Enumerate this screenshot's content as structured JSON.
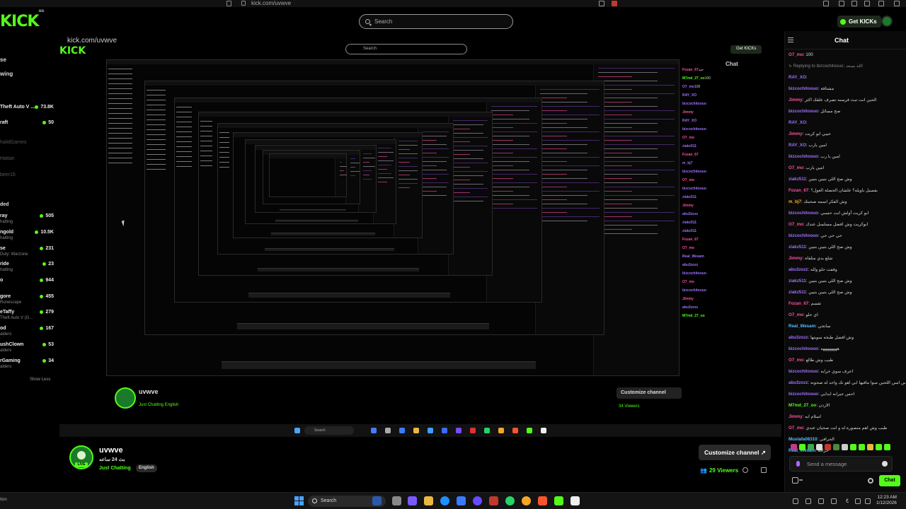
{
  "browser": {
    "url": "kick.com/uvwve"
  },
  "header": {
    "logo": "KICK",
    "logo_sup": "BETA",
    "search_placeholder": "Search",
    "get_kicks": "Get KICKs"
  },
  "sidebar": {
    "nav": [
      "se",
      "wing"
    ],
    "top_items": [
      {
        "name": "Theft Auto V ...",
        "viewers": "73.8K"
      },
      {
        "name": "raft",
        "viewers": "50"
      }
    ],
    "dim_items": [
      "halidGames",
      "Hattan",
      "beer16"
    ],
    "recommended_label": "ded",
    "items": [
      {
        "name": "ray",
        "sub": "hatting",
        "viewers": "505"
      },
      {
        "name": "ngold",
        "sub": "hatting",
        "viewers": "10.5K"
      },
      {
        "name": "se",
        "sub": "Duty: Warzone",
        "viewers": "231"
      },
      {
        "name": "ride",
        "sub": "hatting",
        "viewers": "23"
      },
      {
        "name": "o",
        "sub": "",
        "viewers": "944"
      },
      {
        "name": "gore",
        "sub": "Runescape",
        "viewers": "455"
      },
      {
        "name": "eTaffy",
        "sub": "Theft Auto V (G...",
        "viewers": "279"
      },
      {
        "name": "od",
        "sub": "alders",
        "viewers": "167"
      },
      {
        "name": "ushClown",
        "sub": "alders",
        "viewers": "53"
      },
      {
        "name": "rGaming",
        "sub": "alders",
        "viewers": "34"
      }
    ],
    "show_less": "Show Less"
  },
  "video": {
    "url": "kick.com/uvwve",
    "search": "Search",
    "get_kicks": "Get KICKs",
    "chat_label": "Chat",
    "channel": "uvwve",
    "category": "Just Chatting  English",
    "customize": "Customize channel",
    "viewers": "34 Viewers",
    "task_search": "Search",
    "chat_lines": [
      {
        "u": "Fozan_67",
        "t": "حيه",
        "c": "pk"
      },
      {
        "u": "M7md_27_oo",
        "t": "100",
        "c": "gn"
      },
      {
        "u": "O7_mo",
        "t": "100",
        "c": ""
      },
      {
        "u": "RAY_XO",
        "t": "",
        "c": ""
      },
      {
        "u": "bizcochitoouo",
        "t": "",
        "c": ""
      },
      {
        "u": "Jimmy",
        "t": "",
        "c": "pk"
      },
      {
        "u": "RAY_XO",
        "t": "",
        "c": ""
      },
      {
        "u": "bizcochitoouo",
        "t": "",
        "c": ""
      },
      {
        "u": "O7_mo",
        "t": "",
        "c": "pk"
      },
      {
        "u": "ziakz511",
        "t": "",
        "c": ""
      },
      {
        "u": "Fozan_67",
        "t": "",
        "c": "pk"
      },
      {
        "u": "m_bj7",
        "t": "",
        "c": ""
      },
      {
        "u": "bizcochitoouo",
        "t": "",
        "c": ""
      },
      {
        "u": "O7_mo",
        "t": "",
        "c": "pk"
      },
      {
        "u": "bizcochitoouo",
        "t": "",
        "c": ""
      },
      {
        "u": "ziakz511",
        "t": "",
        "c": ""
      },
      {
        "u": "Jimmy",
        "t": "",
        "c": "pk"
      },
      {
        "u": "abu3zozz",
        "t": "",
        "c": ""
      },
      {
        "u": "ziakz511",
        "t": "",
        "c": ""
      },
      {
        "u": "ziakz511",
        "t": "",
        "c": ""
      },
      {
        "u": "Fozan_67",
        "t": "",
        "c": "pk"
      },
      {
        "u": "O7_mo",
        "t": "",
        "c": "pk"
      },
      {
        "u": "Real_Wesam",
        "t": "",
        "c": ""
      },
      {
        "u": "abu3zozz",
        "t": "",
        "c": ""
      },
      {
        "u": "bizcochitoouo",
        "t": "",
        "c": ""
      },
      {
        "u": "O7_mo",
        "t": "",
        "c": "pk"
      },
      {
        "u": "bizcochitoouo",
        "t": "",
        "c": ""
      },
      {
        "u": "Jimmy",
        "t": "",
        "c": "pk"
      },
      {
        "u": "abu3zozz",
        "t": "",
        "c": ""
      },
      {
        "u": "M7md_27_oo",
        "t": "",
        "c": "gn"
      }
    ]
  },
  "channel": {
    "name": "uvwve",
    "title": "بث 24 ساعه",
    "category": "Just Chatting",
    "tag": "English",
    "live_badge": "LIVE",
    "customize": "Customize channel",
    "viewers": "29 Viewers"
  },
  "chat": {
    "title": "Chat",
    "messages": [
      {
        "user": "O7_mo",
        "text": ": 100",
        "color": "#ff4fa0"
      },
      {
        "user": "",
        "text": "↳ Replying to bizcochitoouo: الله يسعد",
        "color": "#888888",
        "reply": true
      },
      {
        "user": "RAY_XO",
        "text": ": ",
        "color": "#a070ff"
      },
      {
        "user": "bizcochitoouo",
        "text": ": مشتاقة",
        "color": "#a070ff"
      },
      {
        "user": "Jimmy",
        "text": ": الحين انت تبث فرسنه تصرف علقك اكثر",
        "color": "#ff4fa0"
      },
      {
        "user": "bizcochitoouo",
        "text": ": صح مسائل",
        "color": "#a070ff"
      },
      {
        "user": "RAY_XO",
        "text": ": ",
        "color": "#a070ff"
      },
      {
        "user": "Jimmy",
        "text": ": حييي ابو كريت",
        "color": "#ff4fa0"
      },
      {
        "user": "RAY_XO",
        "text": ": امين يارب",
        "color": "#a070ff"
      },
      {
        "user": "bizcochitoouo",
        "text": ": امين يا رب",
        "color": "#a070ff"
      },
      {
        "user": "O7_mo",
        "text": ": امين يارب",
        "color": "#ff4fa0"
      },
      {
        "user": "ziakz511",
        "text": ": وش صح اللي بتبين بتبين",
        "color": "#a070ff"
      },
      {
        "user": "Fozan_67",
        "text": ": بفسيل ياويله؟ علشان الحصلة الغول؟",
        "color": "#ff4fa0"
      },
      {
        "user": "m_bj7",
        "text": ": وش الفكر اسمه صحيتك",
        "color": "#ffb020"
      },
      {
        "user": "bizcochitoouo",
        "text": ": ابو كريت أولش انت حسبي",
        "color": "#a070ff"
      },
      {
        "user": "O7_mo",
        "text": ": ابوكريت وش افضل مسلسل عندك",
        "color": "#ff4fa0"
      },
      {
        "user": "bizcochitoouo",
        "text": ": حي حي حي",
        "color": "#a070ff"
      },
      {
        "user": "ziakz511",
        "text": ": وش صح اللي بتبين بتبين",
        "color": "#a070ff"
      },
      {
        "user": "Jimmy",
        "text": ": شلع بدي متلقاة",
        "color": "#ff4fa0"
      },
      {
        "user": "abu3zozz",
        "text": ": وقفت حلو ولله",
        "color": "#a070ff"
      },
      {
        "user": "ziakz511",
        "text": ": وش صح اللي بتبين بتبين",
        "color": "#a070ff"
      },
      {
        "user": "ziakz511",
        "text": ": وش صح اللي بتبين بتبين",
        "color": "#a070ff"
      },
      {
        "user": "Fozan_67",
        "text": ": تقسم",
        "color": "#ff4fa0"
      },
      {
        "user": "O7_mo",
        "text": ": اي حلو",
        "color": "#ff4fa0"
      },
      {
        "user": "Real_Wesam",
        "text": ": ساتحي",
        "color": "#53c0ff"
      },
      {
        "user": "abu3zozz",
        "text": ": وش افضل طبخه سويتها",
        "color": "#a070ff"
      },
      {
        "user": "bizcochitoouo",
        "text": ": ههههههههه",
        "color": "#a070ff"
      },
      {
        "user": "O7_mo",
        "text": ": طيب وش طالع",
        "color": "#ff4fa0"
      },
      {
        "user": "bizcochitoouo",
        "text": ": اعرف سوي خرابه",
        "color": "#a070ff"
      },
      {
        "user": "abu3zozz",
        "text": ": احس اسن اللحين سوا مافيها ابي اهو تك واحد له صحونه",
        "color": "#a070ff"
      },
      {
        "user": "bizcochitoouo",
        "text": ": احس جيرانه ايدايي",
        "color": "#a070ff"
      },
      {
        "user": "M7md_27_oo",
        "text": ": الاردن",
        "color": "#53fc18"
      },
      {
        "user": "Jimmy",
        "text": ": اسلام ايه",
        "color": "#ff4fa0"
      },
      {
        "user": "O7_mo",
        "text": ": طيب وش اهم منصورة له و انت صحيان عندي",
        "color": "#ff4fa0"
      },
      {
        "user": "Mustafa06310",
        "text": ": الحرافي",
        "color": "#53c0ff"
      },
      {
        "user": "Real_Wesam",
        "text": ": حرافه",
        "color": "#53c0ff"
      }
    ],
    "input_placeholder": "Send a message",
    "kick_points": "∞",
    "send": "Chat"
  },
  "taskbar": {
    "search": "Search",
    "time": "12:23 AM",
    "date": "1/12/2026",
    "lang": "ع",
    "left": "tion"
  }
}
